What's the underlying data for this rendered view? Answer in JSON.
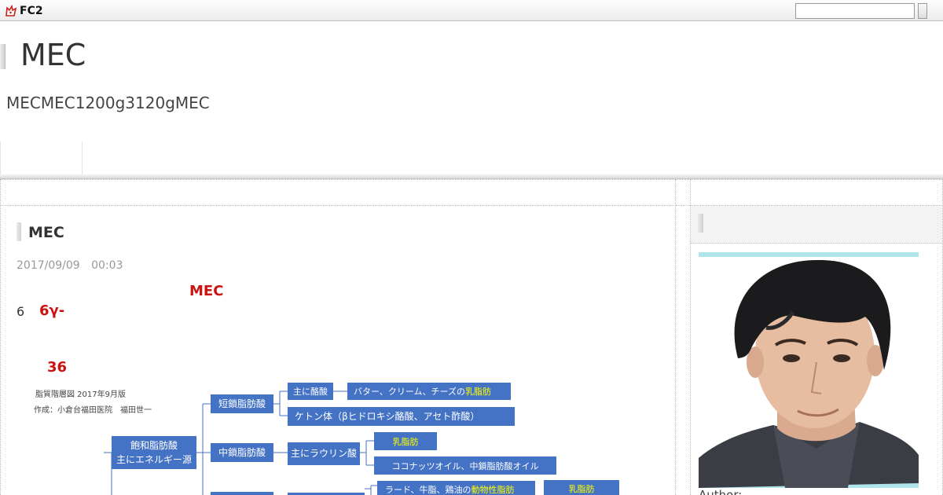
{
  "fc2": {
    "logo_text": "FC2",
    "search_placeholder": ""
  },
  "header": {
    "title": "MEC",
    "description": "MECMEC1200g3120gMEC"
  },
  "entry": {
    "title": "MEC",
    "date": "2017/09/09 00:03",
    "heading": "MEC",
    "number": "6",
    "gamma": "6γ-",
    "count": "36"
  },
  "diagram": {
    "caption_line1": "脂質階層図 2017年9月版",
    "caption_line2": "作成：小倉台福田医院　福田世一",
    "saturated_line1": "飽和脂肪酸",
    "saturated_line2": "主にエネルギー源",
    "short_chain": "短鎖脂肪酸",
    "medium_chain": "中鎖脂肪酸",
    "butyric": "主に酪酸",
    "butter_prefix": "バター、クリーム、チーズの",
    "milk_fat": "乳脂肪",
    "ketone": "ケトン体（βヒドロキシ酪酸、アセト酢酸）",
    "lauric": "主にラウリン酸",
    "milk_fat_box": "乳脂肪",
    "coconut": "ココナッツオイル、中鎖脂肪酸オイル",
    "lard_prefix": "ラード、牛脂、鶏油の",
    "animal_fat": "動物性脂肪",
    "milk_fat_box2": "乳脂肪",
    "box_color": "#4472c4",
    "highlight_color": "#ffff00"
  },
  "sidebar": {
    "author_label": "Author:",
    "accent_color": "#aee6ec"
  }
}
